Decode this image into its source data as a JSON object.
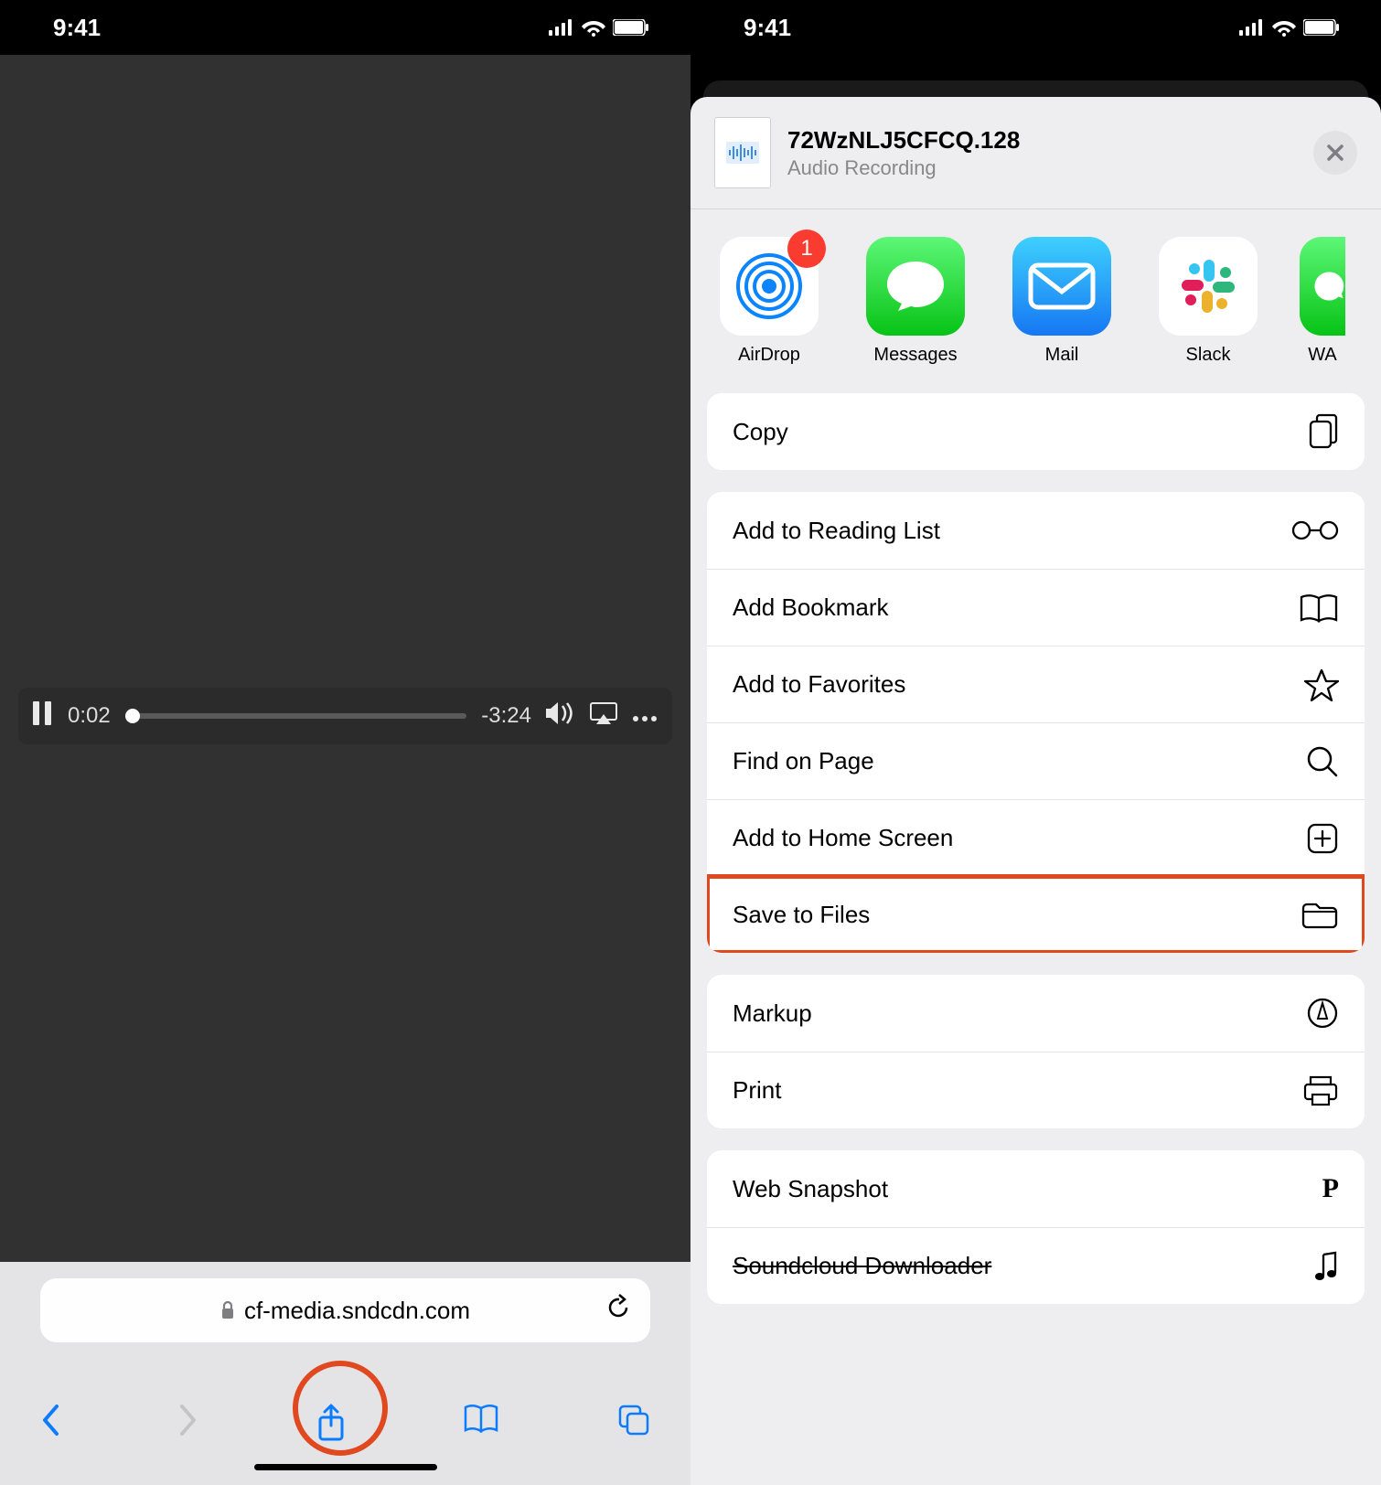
{
  "status": {
    "time": "9:41"
  },
  "left": {
    "player": {
      "elapsed": "0:02",
      "remaining": "-3:24"
    },
    "url_host": "cf-media.sndcdn.com"
  },
  "right": {
    "file": {
      "name": "72WzNLJ5CFCQ.128",
      "subtitle": "Audio Recording"
    },
    "apps": [
      {
        "label": "AirDrop",
        "badge": "1"
      },
      {
        "label": "Messages"
      },
      {
        "label": "Mail"
      },
      {
        "label": "Slack"
      },
      {
        "label": "WA"
      }
    ],
    "actions_group1": [
      {
        "label": "Copy",
        "icon": "copy"
      }
    ],
    "actions_group2": [
      {
        "label": "Add to Reading List",
        "icon": "glasses"
      },
      {
        "label": "Add Bookmark",
        "icon": "book"
      },
      {
        "label": "Add to Favorites",
        "icon": "star"
      },
      {
        "label": "Find on Page",
        "icon": "search"
      },
      {
        "label": "Add to Home Screen",
        "icon": "plus-square"
      },
      {
        "label": "Save to Files",
        "icon": "folder",
        "highlight": true
      }
    ],
    "actions_group3": [
      {
        "label": "Markup",
        "icon": "markup"
      },
      {
        "label": "Print",
        "icon": "printer"
      }
    ],
    "actions_group4": [
      {
        "label": "Web Snapshot",
        "icon": "p-glyph"
      },
      {
        "label": "Soundcloud Downloader",
        "icon": "music",
        "strike": true
      }
    ]
  }
}
